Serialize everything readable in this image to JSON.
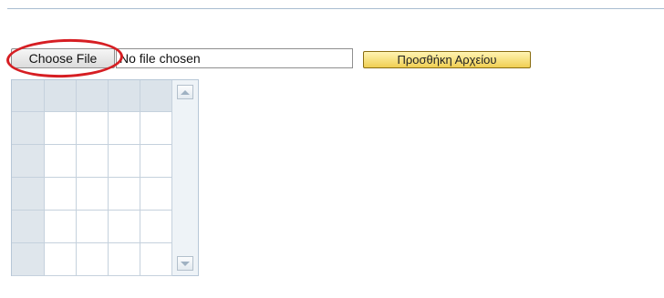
{
  "file_input": {
    "button_label": "Choose File",
    "status_text": "No file chosen"
  },
  "add_file": {
    "label": "Προσθήκη Αρχείου"
  },
  "colors": {
    "highlight_ring": "#d61e23",
    "add_button_bg": "#f0cf52",
    "grid_header_bg": "#dfe6ec"
  },
  "grid": {
    "columns": 5,
    "rows": 6,
    "icons": {
      "scroll_up": "chevron-up-icon",
      "scroll_down": "chevron-down-icon"
    }
  }
}
